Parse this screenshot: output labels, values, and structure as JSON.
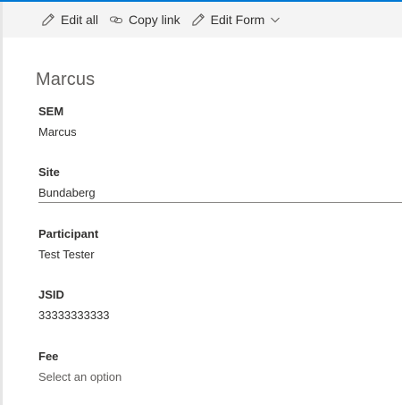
{
  "toolbar": {
    "edit_all": "Edit all",
    "copy_link": "Copy link",
    "edit_form": "Edit Form"
  },
  "title": "Marcus",
  "fields": [
    {
      "label": "SEM",
      "value": "Marcus"
    },
    {
      "label": "Site",
      "value": "Bundaberg"
    },
    {
      "label": "Participant",
      "value": "Test Tester"
    },
    {
      "label": "JSID",
      "value": "33333333333"
    },
    {
      "label": "Fee",
      "value": "Select an option"
    }
  ],
  "colors": {
    "accent": "#0078d4",
    "text": "#323130",
    "muted": "#605e5c",
    "toolbar_bg": "#f4f4f4",
    "panel_bg": "#ffffff"
  },
  "icons": [
    "pencil-icon",
    "link-icon",
    "pencil-icon",
    "chevron-down-icon"
  ]
}
